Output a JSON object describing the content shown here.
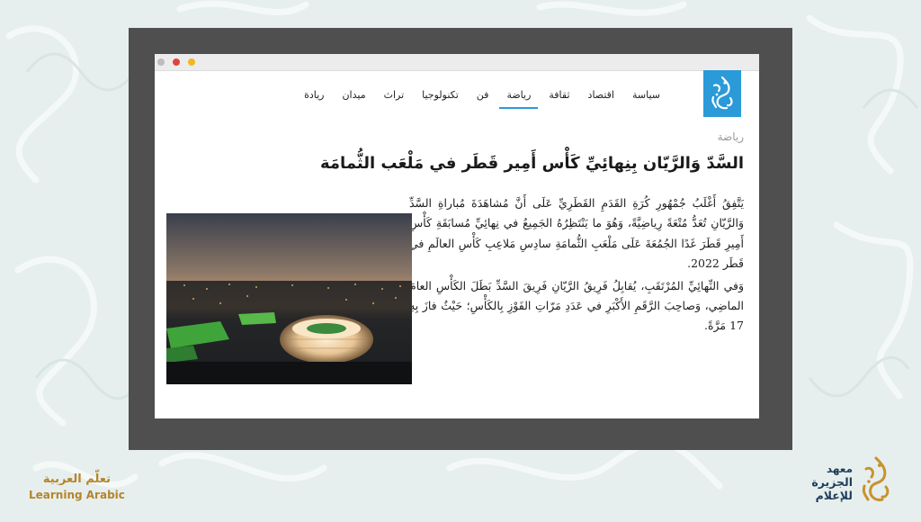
{
  "colors": {
    "background": "#e6efee",
    "frame": "#4f4f4f",
    "accent": "#2b9ad8",
    "brand_gold": "#b6842a",
    "brand_navy": "#1f3d5a"
  },
  "browser": {
    "window_buttons": [
      "grey-button",
      "close-button",
      "minimize-button"
    ]
  },
  "site": {
    "logo": "aljazeera-logo",
    "nav": [
      {
        "label": "سياسة"
      },
      {
        "label": "اقتصاد"
      },
      {
        "label": "ثقافة"
      },
      {
        "label": "رياضة",
        "active": true
      },
      {
        "label": "فن"
      },
      {
        "label": "تكنولوجيا"
      },
      {
        "label": "تراث"
      },
      {
        "label": "ميدان"
      },
      {
        "label": "ريادة"
      }
    ]
  },
  "article": {
    "category": "رياضة",
    "headline": "السَّدّ وَالرَّيّان بِنِهائِيِّ كَأْس أَمِير قَطَر في مَلْعَب الثُّمامَة",
    "paragraphs": [
      "يَتَّفِقُ أَغْلَبُ جُمْهُورِ كُرَةِ القَدَمِ القَطَرِيِّ عَلَى أَنَّ مُشاهَدَةَ مُباراةِ السَّدِّ وَالرَّيّانِ تُعَدُّ مُتْعَةً رِياضِيَّةً، وَهُوَ ما يَنْتَظِرُهُ الجَمِيعُ في نِهائِيِّ مُسابَقَةِ كَأْسِ أَمِيرِ قَطَرَ غَدًا الجُمُعَةَ عَلَى مَلْعَبِ الثُّمامَةِ سادِسِ مَلاعِبِ كَأْسِ العالَمِ في قَطَر 2022.",
      "وَفي النِّهائِيِّ المُرْتَقَبِ، يُقابِلُ فَرِيقُ الرَّيّانِ فَرِيقَ السَّدِّ بَطَلَ الكَأْسِ العامَ الماضِي، وَصاحِبَ الرَّقَمِ الأَكْبَرِ في عَدَدِ مَرّاتِ الفَوْزِ بِالكَأْسِ؛ حَيْثُ فازَ بِهِ 17 مَرَّةً."
    ],
    "image": "stadium-aerial-photo"
  },
  "branding": {
    "left_ar": "تعلّم العربية",
    "left_en": "Learning Arabic",
    "right_line1": "معهد",
    "right_line2": "الجزيرة",
    "right_line3": "للإعلام"
  }
}
